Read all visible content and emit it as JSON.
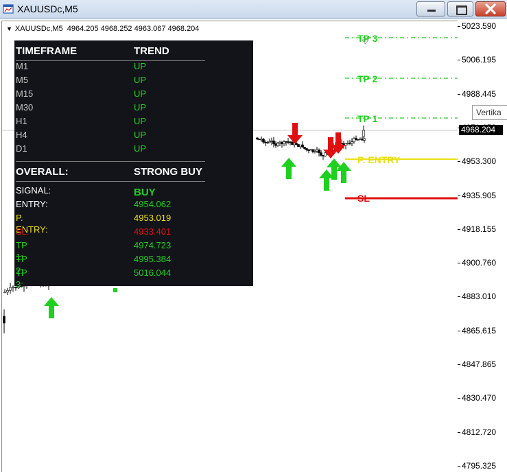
{
  "window": {
    "title": "XAUUSDc,M5",
    "minimize_label": "minimize",
    "maximize_label": "maximize",
    "close_label": "close"
  },
  "chart": {
    "symbol": "XAUUSDc,M5",
    "ohlc": "4964.205 4968.252 4963.067 4968.204",
    "current_price": "4968.204",
    "crosshair_tag": "Vertika",
    "price_scale": [
      "5023.590",
      "5006.195",
      "4988.445",
      "4971.050",
      "4953.300",
      "4935.905",
      "4918.155",
      "4900.760",
      "4883.010",
      "4865.615",
      "4847.865",
      "4830.470",
      "4812.720",
      "4795.325"
    ],
    "levels": {
      "tp3": "TP 3",
      "tp2": "TP 2",
      "tp1": "TP 1",
      "entry": "P. ENTRY",
      "sl": "SL"
    },
    "colors": {
      "up": "#1ed11e",
      "down": "#e01010",
      "entry": "#e8e010",
      "sl": "#e01010",
      "tp": "#1ed11e"
    }
  },
  "panel": {
    "col1_header": "TIMEFRAME",
    "col2_header": "TREND",
    "rows": [
      {
        "tf": "M1",
        "trend": "UP"
      },
      {
        "tf": "M5",
        "trend": "UP"
      },
      {
        "tf": "M15",
        "trend": "UP"
      },
      {
        "tf": "M30",
        "trend": "UP"
      },
      {
        "tf": "H1",
        "trend": "UP"
      },
      {
        "tf": "H4",
        "trend": "UP"
      },
      {
        "tf": "D1",
        "trend": "UP"
      }
    ],
    "overall_label": "OVERALL:",
    "overall_value": "STRONG BUY",
    "signal_label": "SIGNAL:",
    "signal_value": "BUY",
    "entry_label": "ENTRY:",
    "entry_value": "4954.062",
    "pentry_label": "P. ENTRY:",
    "pentry_value": "4953.019",
    "sl_label": "SL:",
    "sl_value": "4933.401",
    "tp1_label": "TP 1:",
    "tp1_value": "4974.723",
    "tp2_label": "TP 2:",
    "tp2_value": "4995.384",
    "tp3_label": "TP 3:",
    "tp3_value": "5016.044"
  }
}
